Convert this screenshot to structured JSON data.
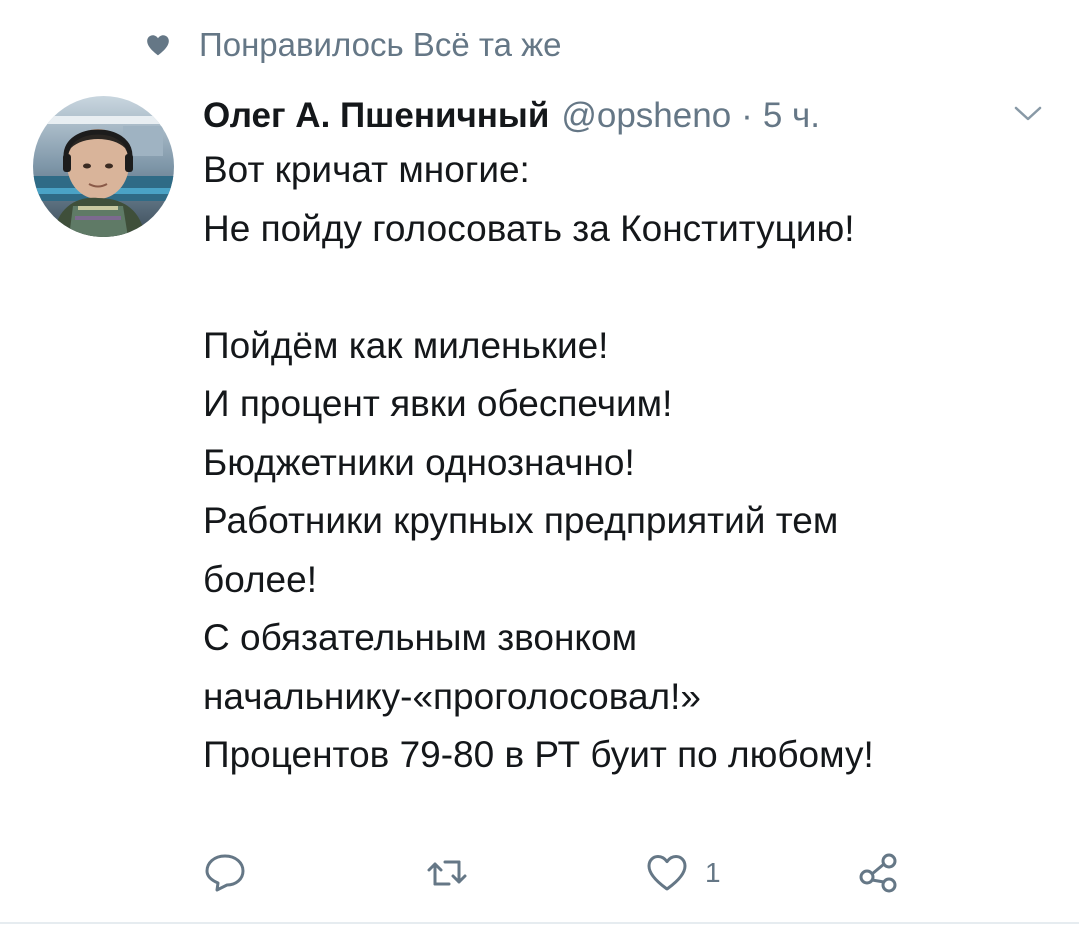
{
  "social_context": {
    "icon": "heart-icon",
    "text": "Понравилось Всё та же"
  },
  "tweet": {
    "author_name": "Олег А. Пшеничный",
    "handle": "@opsheno",
    "separator": "·",
    "time": "5 ч.",
    "lines": [
      "Вот кричат многие:",
      "Не пойду голосовать за Конституцию!",
      "",
      "Пойдём как миленькие!",
      "И процент явки обеспечим!",
      "Бюджетники однозначно!",
      "Работники крупных предприятий тем",
      "более!",
      "С обязательным звонком",
      "начальнику-«проголосовал!»",
      "Процентов 79-80 в РТ буит по любому!"
    ]
  },
  "actions": {
    "reply_icon": "reply-icon",
    "retweet_icon": "retweet-icon",
    "like_icon": "heart-outline-icon",
    "like_count": "1",
    "share_icon": "share-icon"
  },
  "colors": {
    "text": "#14171a",
    "secondary": "#657786",
    "divider": "#e6ecf0"
  }
}
